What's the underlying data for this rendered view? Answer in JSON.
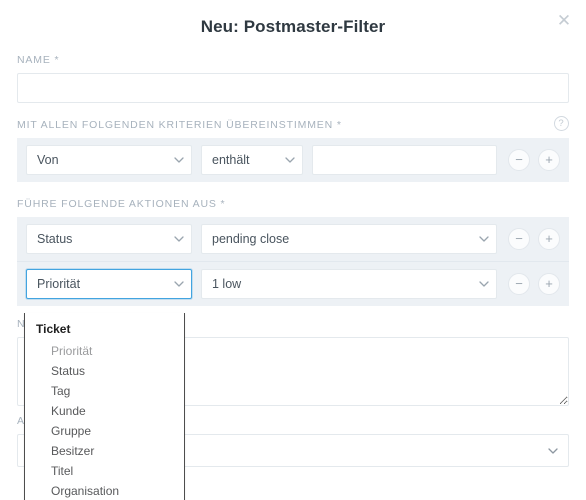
{
  "modal": {
    "title": "Neu: Postmaster-Filter",
    "close_icon": "close-icon",
    "close_glyph": "✕"
  },
  "name_field": {
    "label": "NAME",
    "required_mark": "*",
    "value": "",
    "placeholder": ""
  },
  "criteria": {
    "label": "MIT ALLEN FOLGENDEN KRITERIEN ÜBEREINSTIMMEN",
    "required_mark": "*",
    "help_icon": "help-icon",
    "help_glyph": "?",
    "rows": [
      {
        "attribute": "Von",
        "operator": "enthält",
        "value": "",
        "remove_label": "−",
        "add_label": "+"
      }
    ]
  },
  "actions": {
    "label": "FÜHRE FOLGENDE AKTIONEN AUS",
    "required_mark": "*",
    "rows": [
      {
        "attribute": "Status",
        "value": "pending close",
        "focused": false,
        "remove_label": "−",
        "add_label": "+"
      },
      {
        "attribute": "Priorität",
        "value": "1 low",
        "focused": true,
        "remove_label": "−",
        "add_label": "+"
      }
    ]
  },
  "attribute_dropdown": {
    "open": true,
    "group_label": "Ticket",
    "items": [
      {
        "label": "Priorität",
        "dim": true
      },
      {
        "label": "Status",
        "dim": false
      },
      {
        "label": "Tag",
        "dim": false
      },
      {
        "label": "Kunde",
        "dim": false
      },
      {
        "label": "Gruppe",
        "dim": false
      },
      {
        "label": "Besitzer",
        "dim": false
      },
      {
        "label": "Titel",
        "dim": false
      },
      {
        "label": "Organisation",
        "dim": false
      }
    ]
  },
  "note_field": {
    "label": "N",
    "value": "",
    "placeholder": ""
  },
  "bottom_field": {
    "label": "A",
    "value": "",
    "placeholder": ""
  },
  "colors": {
    "accent": "#42a4e0",
    "row_background": "#edf1f5",
    "label": "#a7b2bd",
    "border": "#e4e9ed",
    "text": "#3b4650",
    "title": "#2f3941"
  }
}
